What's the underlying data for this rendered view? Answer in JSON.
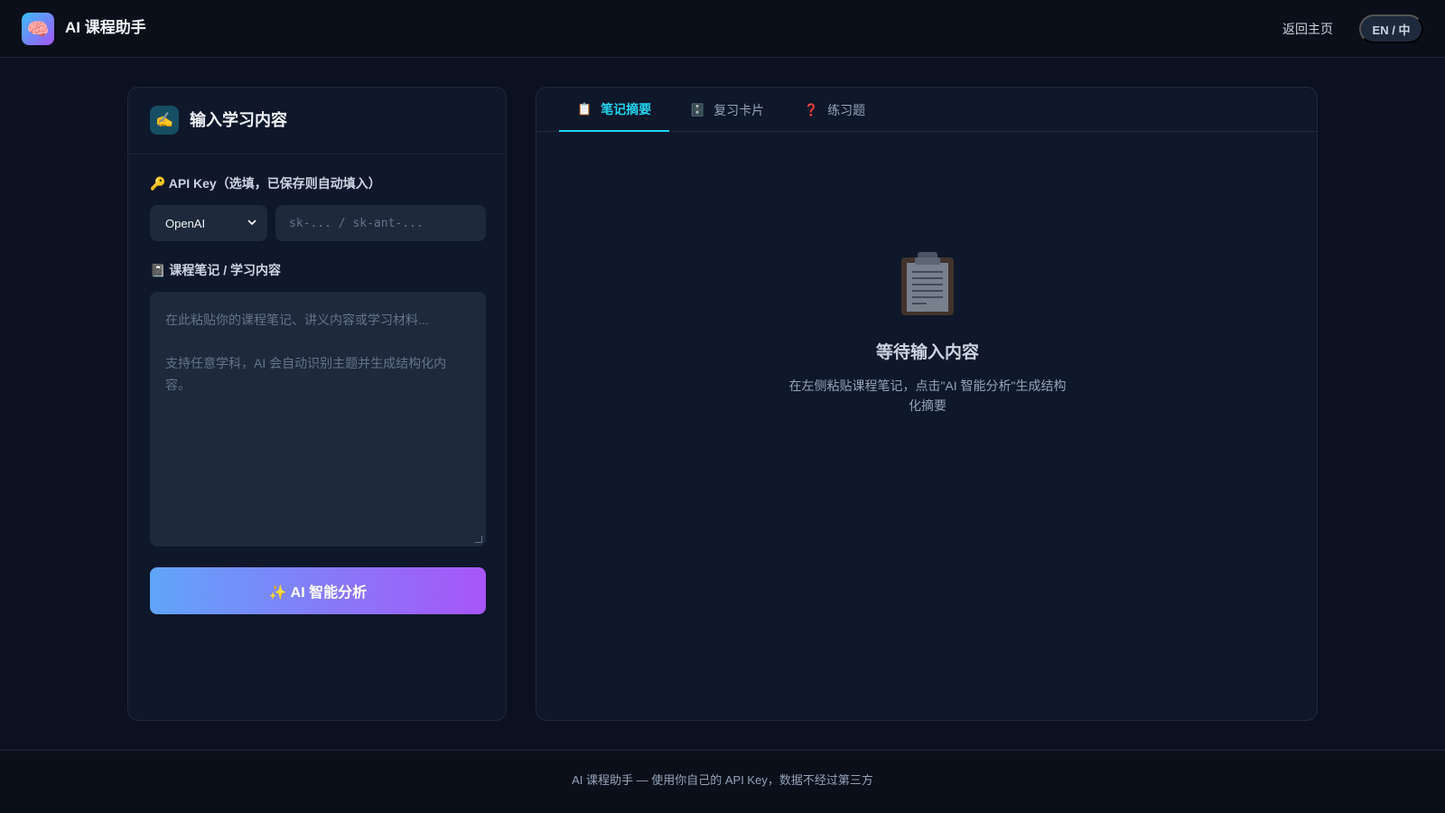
{
  "header": {
    "logo_icon": "brain-icon",
    "logo_emoji": "🧠",
    "title": "AI 课程助手",
    "home_link": "返回主页",
    "lang_toggle": "EN / 中"
  },
  "input_panel": {
    "header_icon": "writing-hand-icon",
    "header_emoji": "✍️",
    "title": "输入学习内容",
    "api_key_label": "🔑 API Key（选填，已保存则自动填入）",
    "provider_selected": "OpenAI",
    "api_key_placeholder": "sk-... / sk-ant-...",
    "notes_label": "📓 课程笔记 / 学习内容",
    "notes_placeholder_line1": "在此粘贴你的课程笔记、讲义内容或学习材料...",
    "notes_placeholder_line2": "支持任意学科，AI 会自动识别主题并生成结构化内容。",
    "analyze_button": "✨ AI 智能分析"
  },
  "output_panel": {
    "tabs": [
      {
        "icon": "📋",
        "label": "笔记摘要",
        "active": true
      },
      {
        "icon": "🗄️",
        "label": "复习卡片",
        "active": false
      },
      {
        "icon": "❓",
        "label": "练习题",
        "active": false
      }
    ],
    "empty_state": {
      "icon": "clipboard-icon",
      "title": "等待输入内容",
      "description": "在左侧粘贴课程笔记，点击\"AI 智能分析\"生成结构化摘要"
    }
  },
  "footer": {
    "text": "AI 课程助手 — 使用你自己的 API Key，数据不经过第三方"
  },
  "colors": {
    "accent": "#22d3ee",
    "background": "#0b1120",
    "panel": "#0f172a",
    "gradient_start": "#60a5fa",
    "gradient_end": "#a855f7"
  }
}
